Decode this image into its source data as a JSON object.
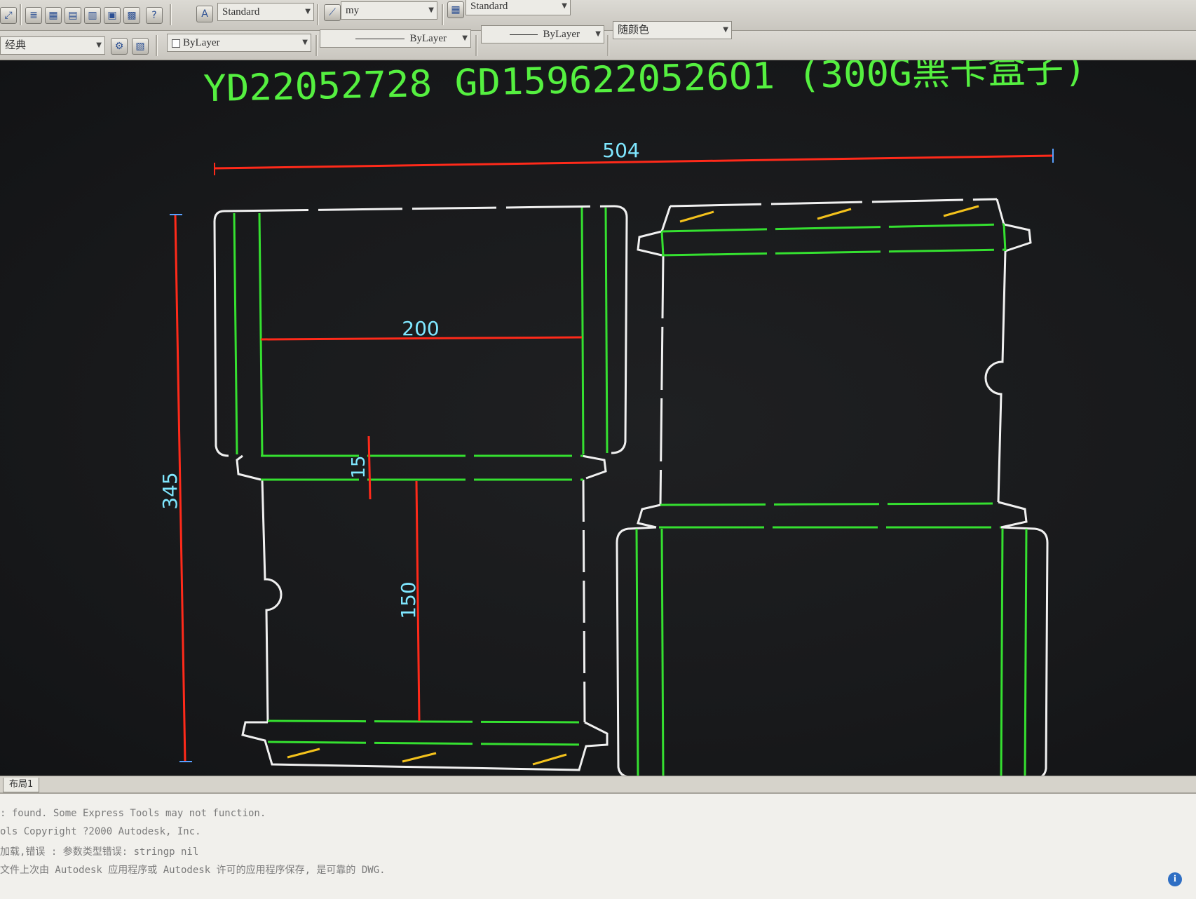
{
  "toolbar_top": {
    "text_style": "Standard",
    "dim_style": "my",
    "table_style": "Standard",
    "help_icon": "help-icon"
  },
  "toolbar_props": {
    "workspace": "经典",
    "layer": "ByLayer",
    "linetype": "ByLayer",
    "lineweight": "ByLayer",
    "color": "随颜色"
  },
  "drawing": {
    "title": "YD22052728 GD1596220526O1 (300G黑卡盒子)",
    "colors": {
      "cut": "#f0f0f0",
      "crease": "#35e030",
      "dimension": "#ff2a1a",
      "dim_text": "#7fe7ff",
      "title": "#55f040",
      "glue": "#f4c21c"
    },
    "dimensions": {
      "overall_width": "504",
      "overall_height": "345",
      "inner_width": "200",
      "tuck_depth": "15",
      "panel_height": "150"
    }
  },
  "layout_tab": "布局1",
  "command_window": {
    "lines": [
      ": found.  Some Express Tools may not function.",
      "ols Copyright ?2000 Autodesk, Inc.",
      "加载,错误 : 参数类型错误: stringp nil",
      "文件上次由 Autodesk 应用程序或 Autodesk 许可的应用程序保存, 是可靠的 DWG."
    ]
  }
}
